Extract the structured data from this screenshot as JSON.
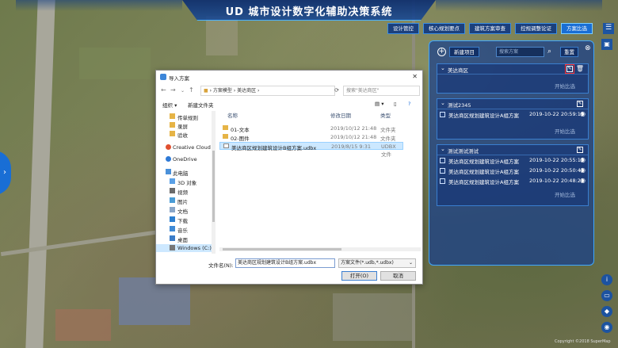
{
  "app": {
    "title": "UD 城市设计数字化辅助决策系统",
    "copyright": "Copyright ©2018 SuperMap"
  },
  "topnav": [
    {
      "label": "设计管控",
      "active": false
    },
    {
      "label": "核心规划要点",
      "active": false
    },
    {
      "label": "建筑方案审查",
      "active": false
    },
    {
      "label": "控规调整论证",
      "active": false
    },
    {
      "label": "方案比选",
      "active": true
    }
  ],
  "panel": {
    "new_label": "新建项目",
    "search_placeholder": "搜索方案",
    "reset_label": "重置",
    "compare_label": "开始比选",
    "groups": [
      {
        "name": "美达商区",
        "items": []
      },
      {
        "name": "测试2345",
        "items": [
          {
            "name": "美达商区规划建筑设计A组方案",
            "time": "2019-10-22 20:59:19"
          }
        ]
      },
      {
        "name": "测试测试测试",
        "items": [
          {
            "name": "美达商区规划建筑设计A组方案",
            "time": "2019-10-22 20:55:15"
          },
          {
            "name": "美达商区规划建筑设计A组方案",
            "time": "2019-10-22 20:50:41"
          },
          {
            "name": "美达商区规划建筑设计A组方案",
            "time": "2019-10-22 20:48:21"
          }
        ]
      }
    ]
  },
  "dialog": {
    "title": "导入方案",
    "path": [
      "方案模型",
      "美达商区"
    ],
    "search_placeholder": "搜索\"美达商区\"",
    "organize_label": "组织 ▾",
    "new_folder_label": "新建文件夹",
    "nav_items": [
      {
        "label": "传单规则",
        "icon": "folder"
      },
      {
        "label": "录屏",
        "icon": "folder"
      },
      {
        "label": "验收",
        "icon": "folder"
      },
      {
        "label": "Creative Cloud F",
        "icon": "cloud"
      },
      {
        "label": "OneDrive",
        "icon": "cloud"
      },
      {
        "label": "此电脑",
        "icon": "pc"
      },
      {
        "label": "3D 对象",
        "icon": "cube"
      },
      {
        "label": "视频",
        "icon": "video"
      },
      {
        "label": "图片",
        "icon": "image"
      },
      {
        "label": "文档",
        "icon": "doc"
      },
      {
        "label": "下载",
        "icon": "download"
      },
      {
        "label": "音乐",
        "icon": "music"
      },
      {
        "label": "桌面",
        "icon": "desktop"
      },
      {
        "label": "Windows (C:)",
        "icon": "drive"
      }
    ],
    "columns": {
      "name": "名称",
      "date": "修改日期",
      "type": "类型"
    },
    "files": [
      {
        "name": "01-文本",
        "date": "2019/10/12 21:48",
        "type": "文件夹",
        "kind": "folder"
      },
      {
        "name": "02-图件",
        "date": "2019/10/12 21:48",
        "type": "文件夹",
        "kind": "folder"
      },
      {
        "name": "美达商区规划建筑设计B组方案.udbx",
        "date": "2019/8/15 9:31",
        "type": "UDBX 文件",
        "kind": "file"
      }
    ],
    "filename_label": "文件名(N):",
    "filename_value": "美达商区规划建筑设计B组方案.udbx",
    "filetype_value": "方案文件(*.udb,*.udbx)",
    "open_label": "打开(O)",
    "cancel_label": "取消"
  },
  "colors": {
    "accent": "#1e6fd9",
    "panel": "#183e8c",
    "highlight": "#ff3030"
  }
}
